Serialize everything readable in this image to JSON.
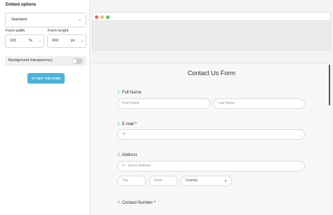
{
  "panel": {
    "title": "Embed options",
    "style_select": "Standard",
    "width_label": "Form width",
    "width_value": "100",
    "width_unit": "%",
    "height_label": "Form height",
    "height_value": "600",
    "height_unit": "px",
    "transparency_label": "Background transparency",
    "get_code": "GET THE CODE",
    "code_icon": "</>"
  },
  "form": {
    "title": "Contact Us Form",
    "q1_num": "1.",
    "q1_label": "Full Name",
    "first_placeholder": "First Name",
    "last_placeholder": "Last Name",
    "q2_num": "2.",
    "q2_label": "E-mail *",
    "q3_num": "3.",
    "q3_label": "Address",
    "street_placeholder": "Street Address",
    "city_placeholder": "City",
    "state_placeholder": "State",
    "country_value": "Country",
    "q4_num": "4.",
    "q4_label": "Contact Number *"
  },
  "colors": {
    "accent": "#4bb3d9",
    "dot_red": "#f25f58",
    "dot_yellow": "#f5be4f",
    "dot_green": "#5bc55b"
  }
}
